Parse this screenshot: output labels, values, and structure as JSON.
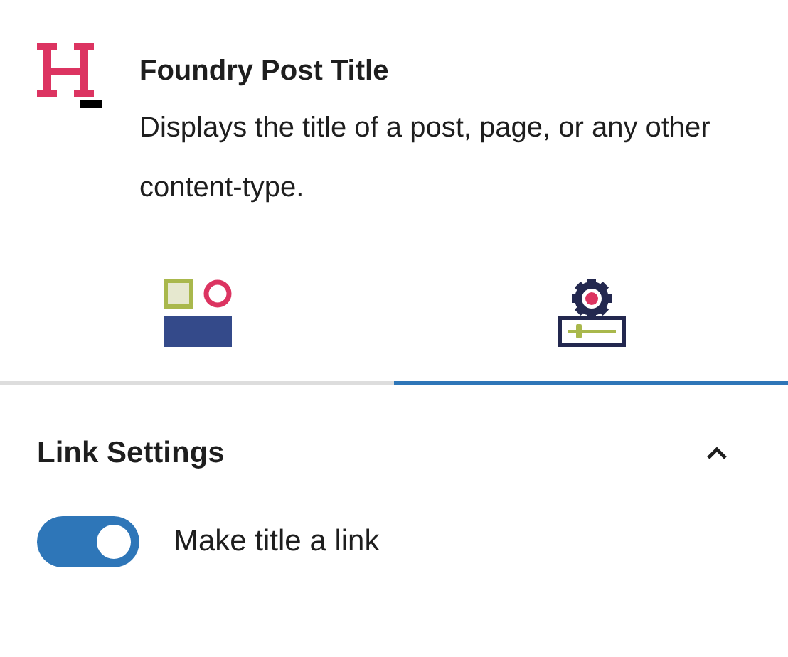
{
  "block": {
    "title": "Foundry Post Title",
    "description": "Displays the title of a post, page, or any other content-type."
  },
  "tabs": [
    {
      "kind": "styles",
      "selected": false
    },
    {
      "kind": "settings",
      "selected": true
    }
  ],
  "panel": {
    "title": "Link Settings",
    "expanded": true,
    "toggles": [
      {
        "label": "Make title a link",
        "on": true
      }
    ]
  }
}
